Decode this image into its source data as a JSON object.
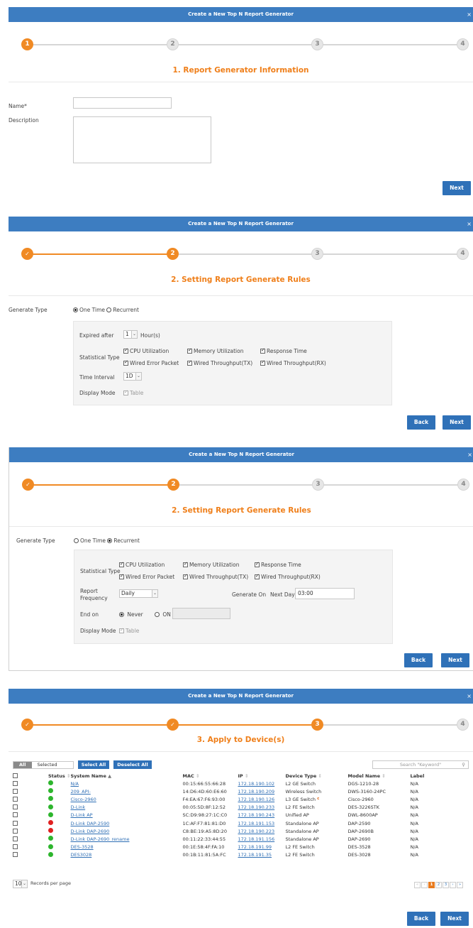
{
  "dialog_title": "Create a New Top N Report Generator",
  "close_symbol": "×",
  "steps": [
    "1",
    "2",
    "3",
    "4"
  ],
  "done_symbol": "✓",
  "panel1": {
    "title": "1. Report Generator Information",
    "name_label": "Name*",
    "description_label": "Description",
    "next": "Next"
  },
  "panel2": {
    "title": "2. Setting Report Generate Rules",
    "generate_type_label": "Generate Type",
    "one_time": "One Time",
    "recurrent": "Recurrent",
    "expired_after_label": "Expired after",
    "expired_value": "1",
    "expired_unit": "Hour(s)",
    "statistical_type_label": "Statistical Type",
    "cpu": "CPU Utilization",
    "memory": "Memory Utilization",
    "response": "Response Time",
    "wired_error": "Wired Error Packet",
    "wired_tx": "Wired Throughput(TX)",
    "wired_rx": "Wired Throughput(RX)",
    "time_interval_label": "Time Interval",
    "time_interval_value": "1D",
    "display_mode_label": "Display Mode",
    "table": "Table",
    "back": "Back",
    "next": "Next"
  },
  "panel3": {
    "title": "2. Setting Report Generate Rules",
    "generate_type_label": "Generate Type",
    "one_time": "One Time",
    "recurrent": "Recurrent",
    "statistical_type_label": "Statistical Type",
    "cpu": "CPU Utilization",
    "memory": "Memory Utilization",
    "response": "Response Time",
    "wired_error": "Wired Error Packet",
    "wired_tx": "Wired Throughput(TX)",
    "wired_rx": "Wired Throughput(RX)",
    "report_frequency_label_1": "Report",
    "report_frequency_label_2": "Frequency",
    "frequency_value": "Daily",
    "generate_on_label": "Generate On",
    "generate_on_value": "Next Day",
    "generate_on_time": "03:00",
    "end_on_label": "End on",
    "never": "Never",
    "on": "ON",
    "display_mode_label": "Display Mode",
    "table": "Table",
    "back": "Back",
    "next": "Next"
  },
  "panel4": {
    "title": "3. Apply to Device(s)",
    "tab_all": "All",
    "tab_selected": "Selected",
    "select_all": "Select All",
    "deselect_all": "Deselect All",
    "search_placeholder": "Search \"Keyword\"",
    "columns": [
      "Status",
      "System Name",
      "MAC",
      "IP",
      "Device Type",
      "Model Name",
      "Label"
    ],
    "sort_marks": [
      "⇕",
      "▲",
      "⇕",
      "⇕",
      "⇕",
      "⇕"
    ],
    "rows": [
      {
        "status": "green",
        "name": "N/A",
        "mac": "00:15:66:55:66:28",
        "ip": "172.18.190.102",
        "type": "L2 GE Switch",
        "model": "DGS-1210-28",
        "label": "N/A"
      },
      {
        "status": "green",
        "name": "209_API-",
        "mac": "14:D6:4D:60:E6:60",
        "ip": "172.18.190.209",
        "type": "Wireless Switch",
        "model": "DWS-3160-24PC",
        "label": "N/A"
      },
      {
        "status": "green",
        "name": "Cisco-2960",
        "mac": "F4:EA:67:F6:93:00",
        "ip": "172.18.190.126",
        "type": "L3 GE Switch",
        "type_mark": "c",
        "model": "Cisco-2960",
        "label": "N/A"
      },
      {
        "status": "green",
        "name": "D-Link",
        "mac": "00:05:5D:8F:12:52",
        "ip": "172.18.190.233",
        "type": "L2 FE Switch",
        "model": "DES-3226STK",
        "label": "N/A"
      },
      {
        "status": "green",
        "name": "D-Link AP",
        "mac": "SC:D9:98:27:1C:C0",
        "ip": "172.18.190.243",
        "type": "Unified AP",
        "model": "DWL-8600AP",
        "label": "N/A"
      },
      {
        "status": "red",
        "name": "D-Link DAP-2590",
        "mac": "1C:AF:F7:81:81:D0",
        "ip": "172.18.191.153",
        "type": "Standalone AP",
        "model": "DAP-2590",
        "label": "N/A"
      },
      {
        "status": "red",
        "name": "D-Link DAP-2690",
        "mac": "C8:BE:19:A5:8D:20",
        "ip": "172.18.190.223",
        "type": "Standalone AP",
        "model": "DAP-2690B",
        "label": "N/A"
      },
      {
        "status": "green",
        "name": "D-Link DAP-2690_rename",
        "mac": "00:11:22:33:44:55",
        "ip": "172.18.191.156",
        "type": "Standalone AP",
        "model": "DAP-2690",
        "label": "N/A"
      },
      {
        "status": "green",
        "name": "DES-3528",
        "mac": "00:1E:58:4F:FA:10",
        "ip": "172.18.191.99",
        "type": "L2 FE Switch",
        "model": "DES-3528",
        "label": "N/A"
      },
      {
        "status": "green",
        "name": "DES3028",
        "mac": "00:1B:11:81:5A:FC",
        "ip": "172.18.191.35",
        "type": "L2 FE Switch",
        "model": "DES-3028",
        "label": "N/A"
      }
    ],
    "per_page_value": "10",
    "records_per_page": "Records per page",
    "pages": [
      "1",
      "2",
      "3"
    ],
    "back": "Back",
    "next": "Next"
  },
  "colors": {
    "header": "#3d7dc1",
    "accent": "#f08a24",
    "button": "#2f71b8",
    "status_green": "#2db52d",
    "status_red": "#e02020"
  }
}
